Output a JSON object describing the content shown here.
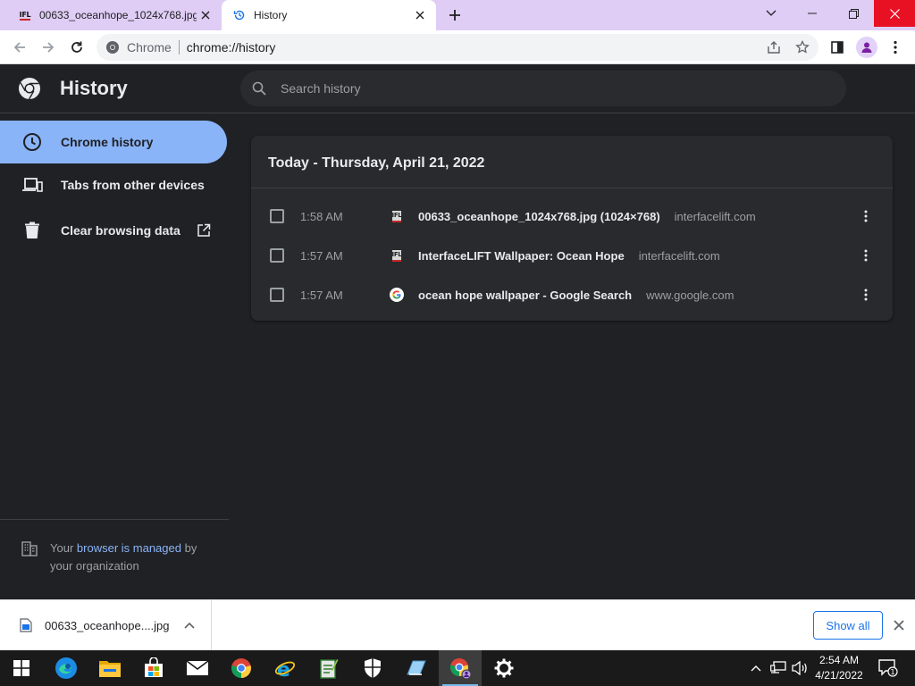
{
  "tabs": [
    {
      "title": "00633_oceanhope_1024x768.jpg",
      "favicon": "ifl-favicon",
      "active": false
    },
    {
      "title": "History",
      "favicon": "history-icon",
      "active": true
    }
  ],
  "ifl_logo_text": "IFL",
  "toolbar": {
    "omnibox_chip": "Chrome",
    "omnibox_url": "chrome://history"
  },
  "history": {
    "page_title": "History",
    "search_placeholder": "Search history",
    "sidebar": {
      "items": [
        {
          "label": "Chrome history",
          "icon": "clock-icon",
          "selected": true
        },
        {
          "label": "Tabs from other devices",
          "icon": "devices-icon",
          "selected": false
        },
        {
          "label": "Clear browsing data",
          "icon": "trash-icon",
          "selected": false
        }
      ],
      "managed_prefix": "Your",
      "managed_link": "browser is managed",
      "managed_suffix": "by",
      "managed_line2": "your organization"
    },
    "day_heading": "Today - Thursday, April 21, 2022",
    "entries": [
      {
        "time": "1:58 AM",
        "title": "00633_oceanhope_1024x768.jpg (1024×768)",
        "domain": "interfacelift.com",
        "favicon": "ifl-favicon"
      },
      {
        "time": "1:57 AM",
        "title": "InterfaceLIFT Wallpaper: Ocean Hope",
        "domain": "interfacelift.com",
        "favicon": "ifl-favicon"
      },
      {
        "time": "1:57 AM",
        "title": "ocean hope wallpaper - Google Search",
        "domain": "www.google.com",
        "favicon": "google-icon"
      }
    ]
  },
  "download_bar": {
    "filename": "00633_oceanhope....jpg",
    "show_all": "Show all"
  },
  "taskbar": {
    "time": "2:54 AM",
    "date": "4/21/2022",
    "notification_count": "1"
  },
  "colors": {
    "tabstrip": "#dfcdf5",
    "page_bg": "#202124",
    "card_bg": "#292a2d",
    "selected_nav": "#8ab4f8",
    "link": "#8ab4f8",
    "close_button": "#e81123",
    "accent_blue": "#1a73e8"
  }
}
